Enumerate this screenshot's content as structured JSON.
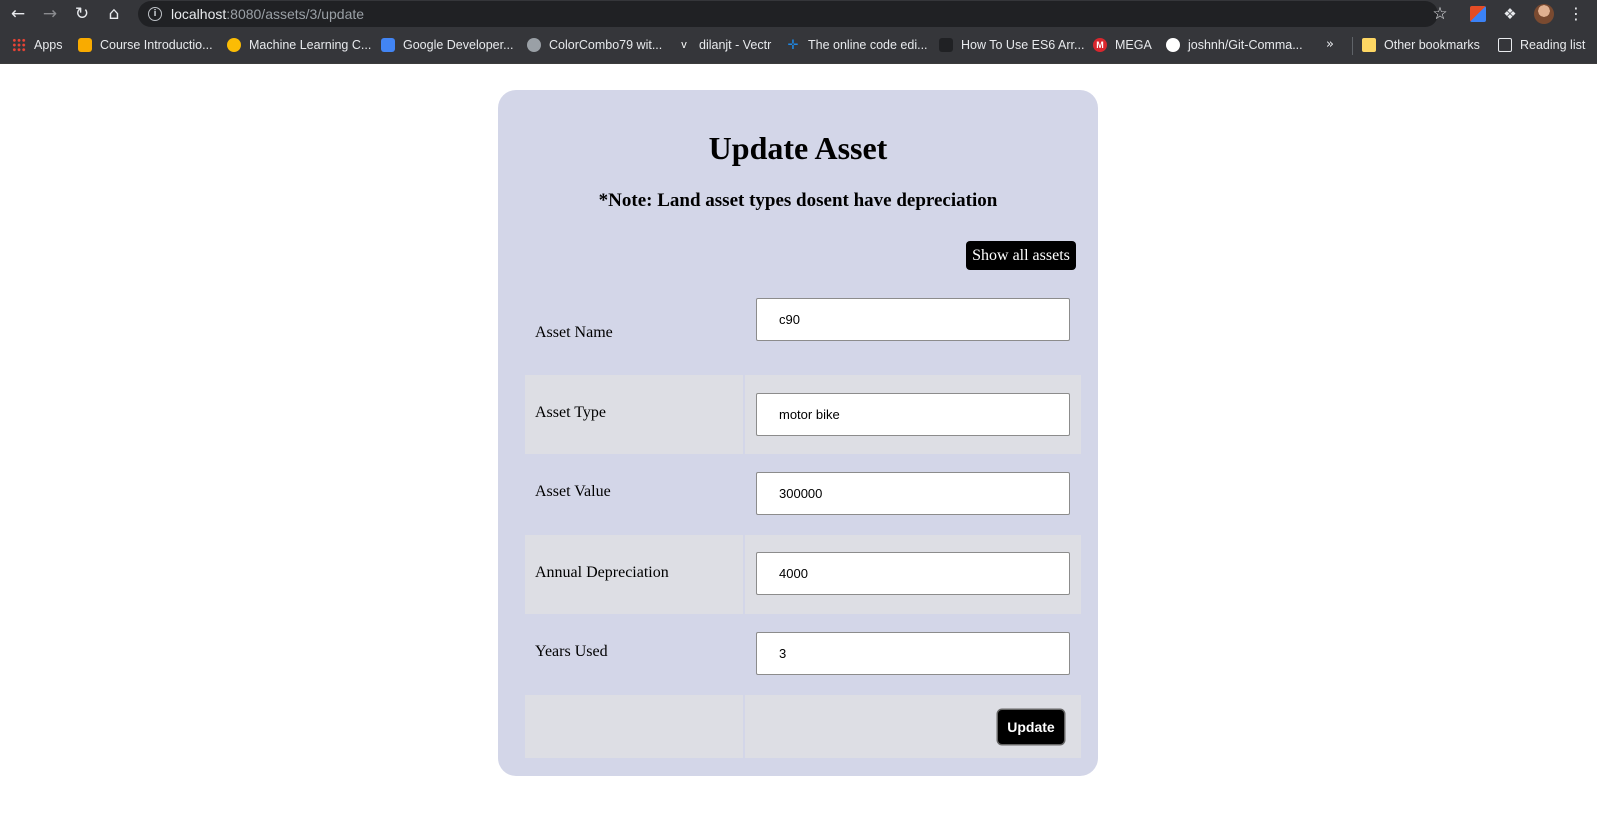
{
  "browser": {
    "url_host": "localhost",
    "url_path": ":8080/assets/3/update",
    "bookmarks": [
      {
        "label": "Apps",
        "color": "#ea4335"
      },
      {
        "label": "Course Introductio...",
        "color": "#f9ab00"
      },
      {
        "label": "Machine Learning C...",
        "color": "#fbbc04"
      },
      {
        "label": "Google Developer...",
        "color": "#4285f4"
      },
      {
        "label": "ColorCombo79 wit...",
        "color": "#9aa0a6"
      },
      {
        "label": "dilanjt - Vectr",
        "color": "#ffffff"
      },
      {
        "label": "The online code edi...",
        "color": "#1e88e5"
      },
      {
        "label": "How To Use ES6 Arr...",
        "color": "#202124"
      },
      {
        "label": "MEGA",
        "color": "#d9272e"
      },
      {
        "label": "joshnh/Git-Comma...",
        "color": "#ffffff"
      }
    ],
    "more_bookmarks": "»",
    "other_bookmarks": "Other bookmarks",
    "reading_list": "Reading list"
  },
  "page": {
    "title": "Update Asset",
    "note": "*Note: Land asset types dosent have depreciation",
    "show_all_label": "Show all assets",
    "fields": {
      "asset_name": {
        "label": "Asset Name",
        "value": "c90"
      },
      "asset_type": {
        "label": "Asset Type",
        "value": "motor bike"
      },
      "asset_value": {
        "label": "Asset Value",
        "value": "300000"
      },
      "annual_depreciation": {
        "label": "Annual Depreciation",
        "value": "4000"
      },
      "years_used": {
        "label": "Years Used",
        "value": "3"
      }
    },
    "update_label": "Update"
  },
  "colors": {
    "card_bg": "#d3d6e8",
    "alt_row_bg": "#dddee4",
    "button_bg": "#000000"
  }
}
